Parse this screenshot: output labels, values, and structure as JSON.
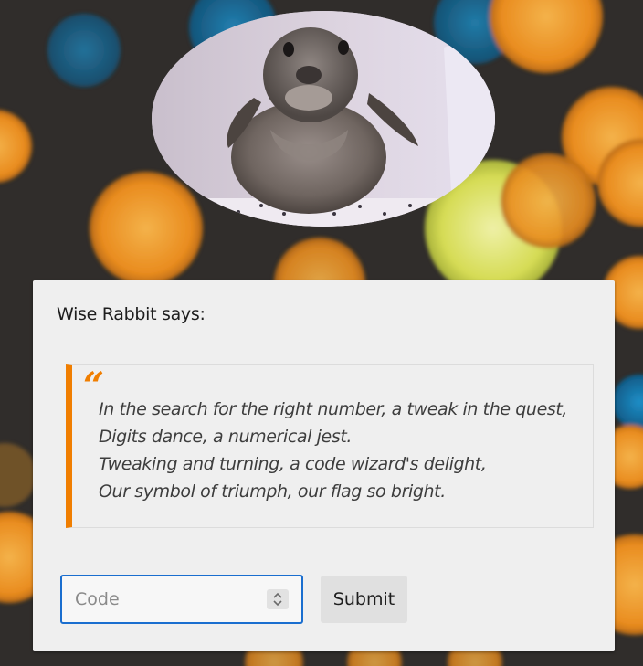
{
  "header": {
    "avatar_icon": "rabbit-photo"
  },
  "card": {
    "speaker_label": "Wise Rabbit says:",
    "quote_mark": "“",
    "quote_lines": [
      "In the search for the right number, a tweak in the quest,",
      "Digits dance, a numerical jest.",
      "Tweaking and turning, a code wizard's delight,",
      "Our symbol of triumph, our flag so bright."
    ]
  },
  "form": {
    "code_placeholder": "Code",
    "code_value": "",
    "submit_label": "Submit"
  },
  "colors": {
    "accent": "#f07e00",
    "focus_border": "#1a6ecf",
    "card_background": "#efefef"
  }
}
